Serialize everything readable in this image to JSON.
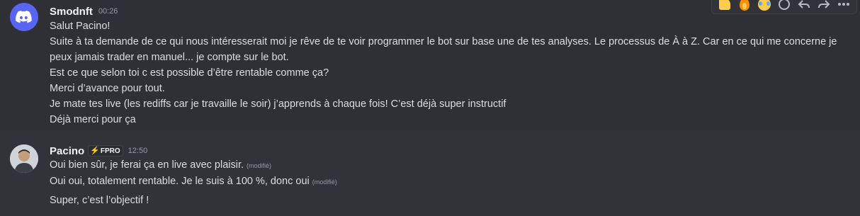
{
  "messages": [
    {
      "author": "Smodnft",
      "timestamp": "00:26",
      "lines": [
        "Salut Pacino!",
        "Suite à ta demande de ce qui nous intéresserait moi je rêve de te voir programmer le bot sur base une de tes analyses. Le processus de À à Z. Car en ce qui me concerne je peux jamais trader en manuel... je compte sur le bot.",
        "Est ce que selon toi c est possible d’être rentable comme ça?",
        "Merci d’avance pour tout.",
        "Je mate tes live (les rediffs car je travaille le soir) j’apprends à chaque fois! C’est déjà super instructif",
        "Déjà merci pour ça"
      ]
    },
    {
      "author": "Pacino",
      "badge": "FPRO",
      "timestamp": "12:50",
      "lines": [
        {
          "text": "Oui bien sûr, je ferai ça en live avec plaisir.",
          "edited": "(modifié)"
        },
        {
          "text": "Oui oui, totalement rentable. Je le suis à 100 %, donc oui",
          "edited": "(modifié)"
        },
        {
          "text": "Super, c’est l’objectif !",
          "edited": ""
        }
      ]
    }
  ],
  "toolbar": {
    "icons": [
      "thumbs-up-emoji",
      "fire-emoji",
      "joy-emoji",
      "add-reaction-icon",
      "reply-icon",
      "forward-icon",
      "more-icon"
    ]
  },
  "colors": {
    "background": "#313338",
    "hover_background": "#2e3035",
    "discord_blurple": "#5865f2",
    "text": "#dbdee1",
    "muted": "#949ba4",
    "badge_bolt": "#23a559"
  }
}
